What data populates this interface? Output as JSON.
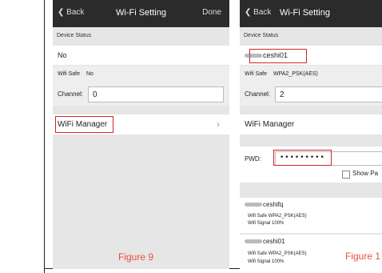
{
  "phone1": {
    "back": "Back",
    "title": "Wi-Fi Setting",
    "done": "Done",
    "device_status_label": "Device Status",
    "status_value": "No",
    "wifi_safe_label": "Wifi Safe",
    "wifi_safe_value": "No",
    "channel_label": "Channel:",
    "channel_value": "0",
    "wifi_manager": "WiFi Manager",
    "caption": "Figure 9"
  },
  "phone2": {
    "back": "Back",
    "title": "Wi-Fi Setting",
    "device_status_label": "Device Status",
    "device_name": "ceshi01",
    "wifi_safe_label": "Wifi Safe",
    "wifi_safe_value": "WPA2_PSK(AES)",
    "channel_label": "Channel:",
    "channel_value": "2",
    "wifi_manager": "WiFi Manager",
    "pwd_label": "PWD:",
    "pwd_value": "•••••••••",
    "show_password": "Show Pa",
    "networks": [
      {
        "name": "ceshifq",
        "safe_label": "Wifi Safe",
        "safe": "WPA2_PSK(AES)",
        "signal_label": "Wifi Signal",
        "signal": "100%"
      },
      {
        "name": "ceshi01",
        "safe_label": "Wifi Safe",
        "safe": "WPA2_PSK(AES)",
        "signal_label": "Wifi Signal",
        "signal": "100%"
      }
    ],
    "caption": "Figure 1"
  }
}
